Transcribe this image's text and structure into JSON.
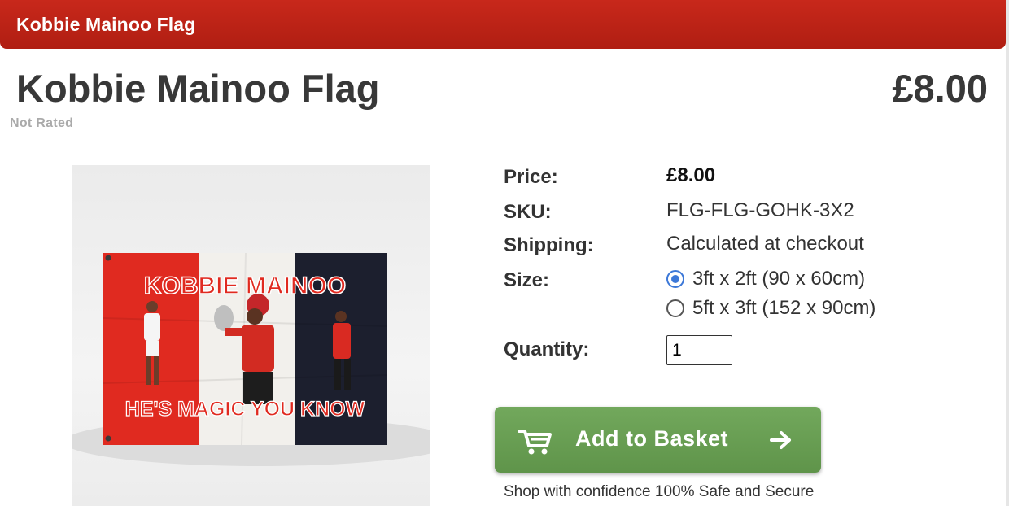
{
  "header": {
    "title": "Kobbie Mainoo Flag"
  },
  "product": {
    "name": "Kobbie Mainoo Flag",
    "price": "£8.00",
    "rating": "Not Rated",
    "image": {
      "top_text": "KOBBIE MAINOO",
      "bottom_text": "HE'S MAGIC YOU KNOW",
      "colors": {
        "red": "#e02a20",
        "white": "#f2f0ec",
        "navy": "#1c1f2e"
      }
    }
  },
  "details": {
    "price_label": "Price:",
    "price_value": "£8.00",
    "sku_label": "SKU:",
    "sku_value": "FLG-FLG-GOHK-3X2",
    "shipping_label": "Shipping:",
    "shipping_value": "Calculated at checkout",
    "size_label": "Size:",
    "size_options": [
      {
        "label": "3ft x 2ft (90 x 60cm)",
        "selected": true
      },
      {
        "label": "5ft x 3ft (152 x 90cm)",
        "selected": false
      }
    ],
    "quantity_label": "Quantity:",
    "quantity_value": "1"
  },
  "actions": {
    "add_to_basket": "Add to Basket",
    "cart_icon": "cart-icon",
    "arrow_icon": "arrow-right-icon",
    "secure_note": "Shop with confidence 100% Safe and Secure",
    "button_color": "#66a052"
  },
  "theme": {
    "header_red": "#c0241a",
    "accent_blue": "#3c78d8"
  }
}
